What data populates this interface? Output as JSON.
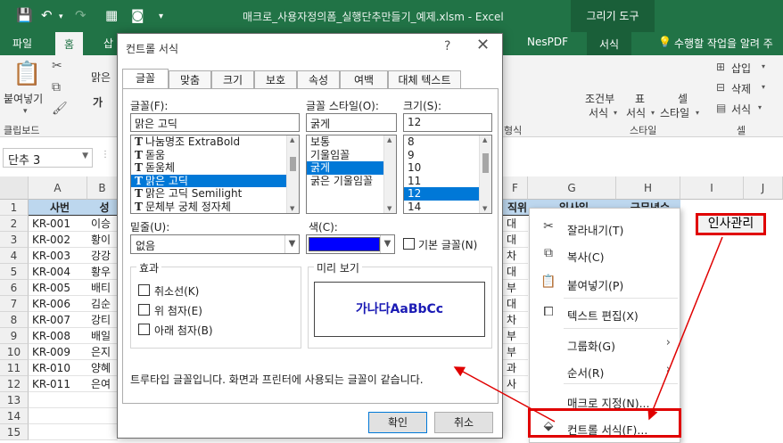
{
  "titlebar": {
    "doc_title": "매크로_사용자정의폼_실행단추만들기_예제.xlsm - Excel",
    "context_tab": "그리기 도구"
  },
  "tabs": {
    "file": "파일",
    "home": "홈",
    "insert_partial": "삽",
    "nespdf": "NesPDF",
    "format": "서식",
    "tell_me": "수행할 작업을 알려 주"
  },
  "ribbon": {
    "paste": "붙여넣기",
    "clipboard_group": "클립보드",
    "font_partial": "맑은",
    "bold_partial": "가",
    "conditional_format": "조건부",
    "format_as": "서식",
    "table": "표",
    "table_format": "서식",
    "cell": "셀",
    "cell_style": "스타일",
    "style_group": "스타일",
    "alignment_partial": "형식",
    "insert": "삽입",
    "delete": "삭제",
    "format_cells": "서식",
    "cells_group": "셀"
  },
  "namebox": {
    "value": "단추 3"
  },
  "sheet": {
    "columns": [
      "A",
      "B",
      "F",
      "G",
      "H",
      "I",
      "J"
    ],
    "rows": [
      "1",
      "2",
      "3",
      "4",
      "5",
      "6",
      "7",
      "8",
      "9",
      "10",
      "11",
      "12",
      "13",
      "14",
      "15"
    ],
    "header_row": {
      "a": "사번",
      "b": "성",
      "f": "직위",
      "g": "입사일",
      "h": "근무년수"
    },
    "a_values": [
      "KR-001",
      "KR-002",
      "KR-003",
      "KR-004",
      "KR-005",
      "KR-006",
      "KR-007",
      "KR-008",
      "KR-009",
      "KR-010",
      "KR-011"
    ],
    "b_values": [
      "이승",
      "황이",
      "강강",
      "황우",
      "배티",
      "김순",
      "강티",
      "배일",
      "은지",
      "양혜",
      "은여"
    ],
    "f_values": [
      "대",
      "대",
      "차",
      "대",
      "부",
      "대",
      "차",
      "부",
      "부",
      "과",
      "사"
    ]
  },
  "dialog": {
    "title": "컨트롤 서식",
    "help": "?",
    "close": "✕",
    "tabs": [
      "글꼴",
      "맞춤",
      "크기",
      "보호",
      "속성",
      "여백",
      "대체 텍스트"
    ],
    "font_label": "글꼴(F):",
    "font_value": "맑은 고딕",
    "font_list": [
      "나눔명조 ExtraBold",
      "돋움",
      "돋움체",
      "맑은 고딕",
      "맑은 고딕 Semilight",
      "문체부 궁체 정자체"
    ],
    "style_label": "글꼴 스타일(O):",
    "style_value": "굵게",
    "style_list": [
      "보통",
      "기울임꼴",
      "굵게",
      "굵은 기울임꼴"
    ],
    "size_label": "크기(S):",
    "size_value": "12",
    "size_list": [
      "8",
      "9",
      "10",
      "11",
      "12",
      "14"
    ],
    "underline_label": "밑줄(U):",
    "underline_value": "없음",
    "color_label": "색(C):",
    "color_value": "#0000ff",
    "normal_font": "기본 글꼴(N)",
    "effects_legend": "효과",
    "strikethrough": "취소선(K)",
    "superscript": "위 첨자(E)",
    "subscript": "아래 첨자(B)",
    "preview_legend": "미리 보기",
    "preview_text": "가나다AaBbCc",
    "info_text": "트루타입 글꼴입니다. 화면과 프린터에 사용되는 글꼴이 같습니다.",
    "ok": "확인",
    "cancel": "취소"
  },
  "context_menu": {
    "items": [
      "잘라내기(T)",
      "복사(C)",
      "붙여넣기(P)",
      "텍스트 편집(X)",
      "그룹화(G)",
      "순서(R)",
      "매크로 지정(N)...",
      "컨트롤 서식(F)..."
    ]
  },
  "shape_button": {
    "label": "인사관리"
  },
  "colors": {
    "excel_green": "#217346",
    "highlight_red": "#e00000",
    "header_fill": "#bdd7ee"
  }
}
